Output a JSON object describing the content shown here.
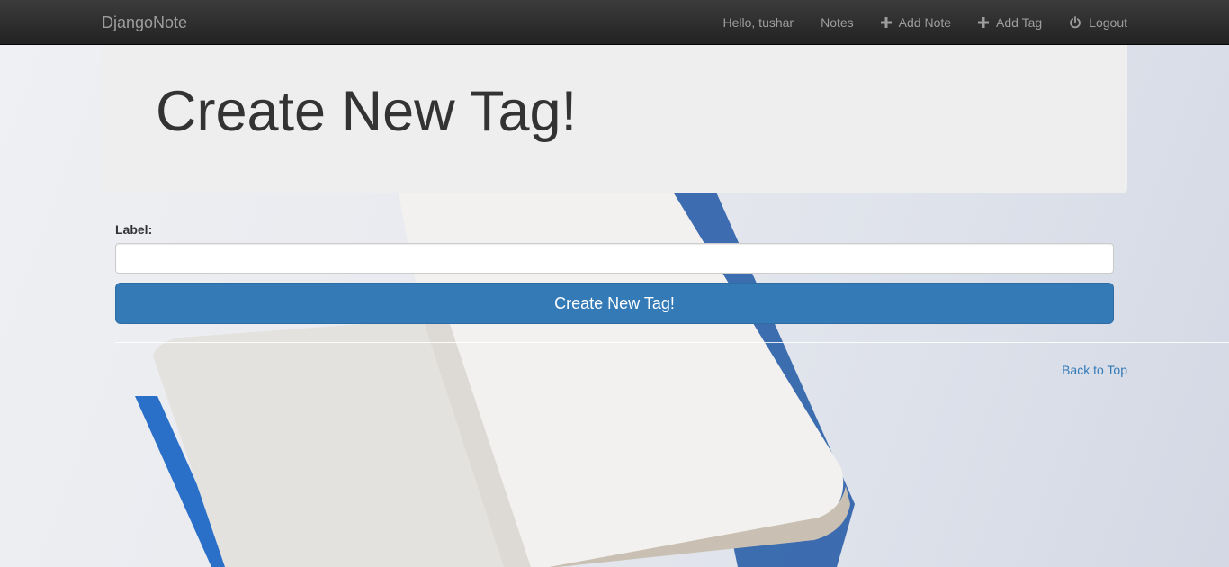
{
  "navbar": {
    "brand": "DjangoNote",
    "greeting": "Hello, tushar",
    "items": [
      {
        "label": "Notes",
        "icon": ""
      },
      {
        "label": "Add Note",
        "icon": "plus-icon"
      },
      {
        "label": "Add Tag",
        "icon": "plus-icon"
      },
      {
        "label": "Logout",
        "icon": "power-icon"
      }
    ]
  },
  "jumbotron": {
    "title": "Create New Tag!"
  },
  "form": {
    "label": "Label:",
    "input_value": "",
    "submit_label": "Create New Tag!"
  },
  "footer": {
    "back_to_top": "Back to Top"
  },
  "colors": {
    "navbar": "#222222",
    "primary": "#337ab7",
    "jumbotron": "#eeeeee"
  }
}
